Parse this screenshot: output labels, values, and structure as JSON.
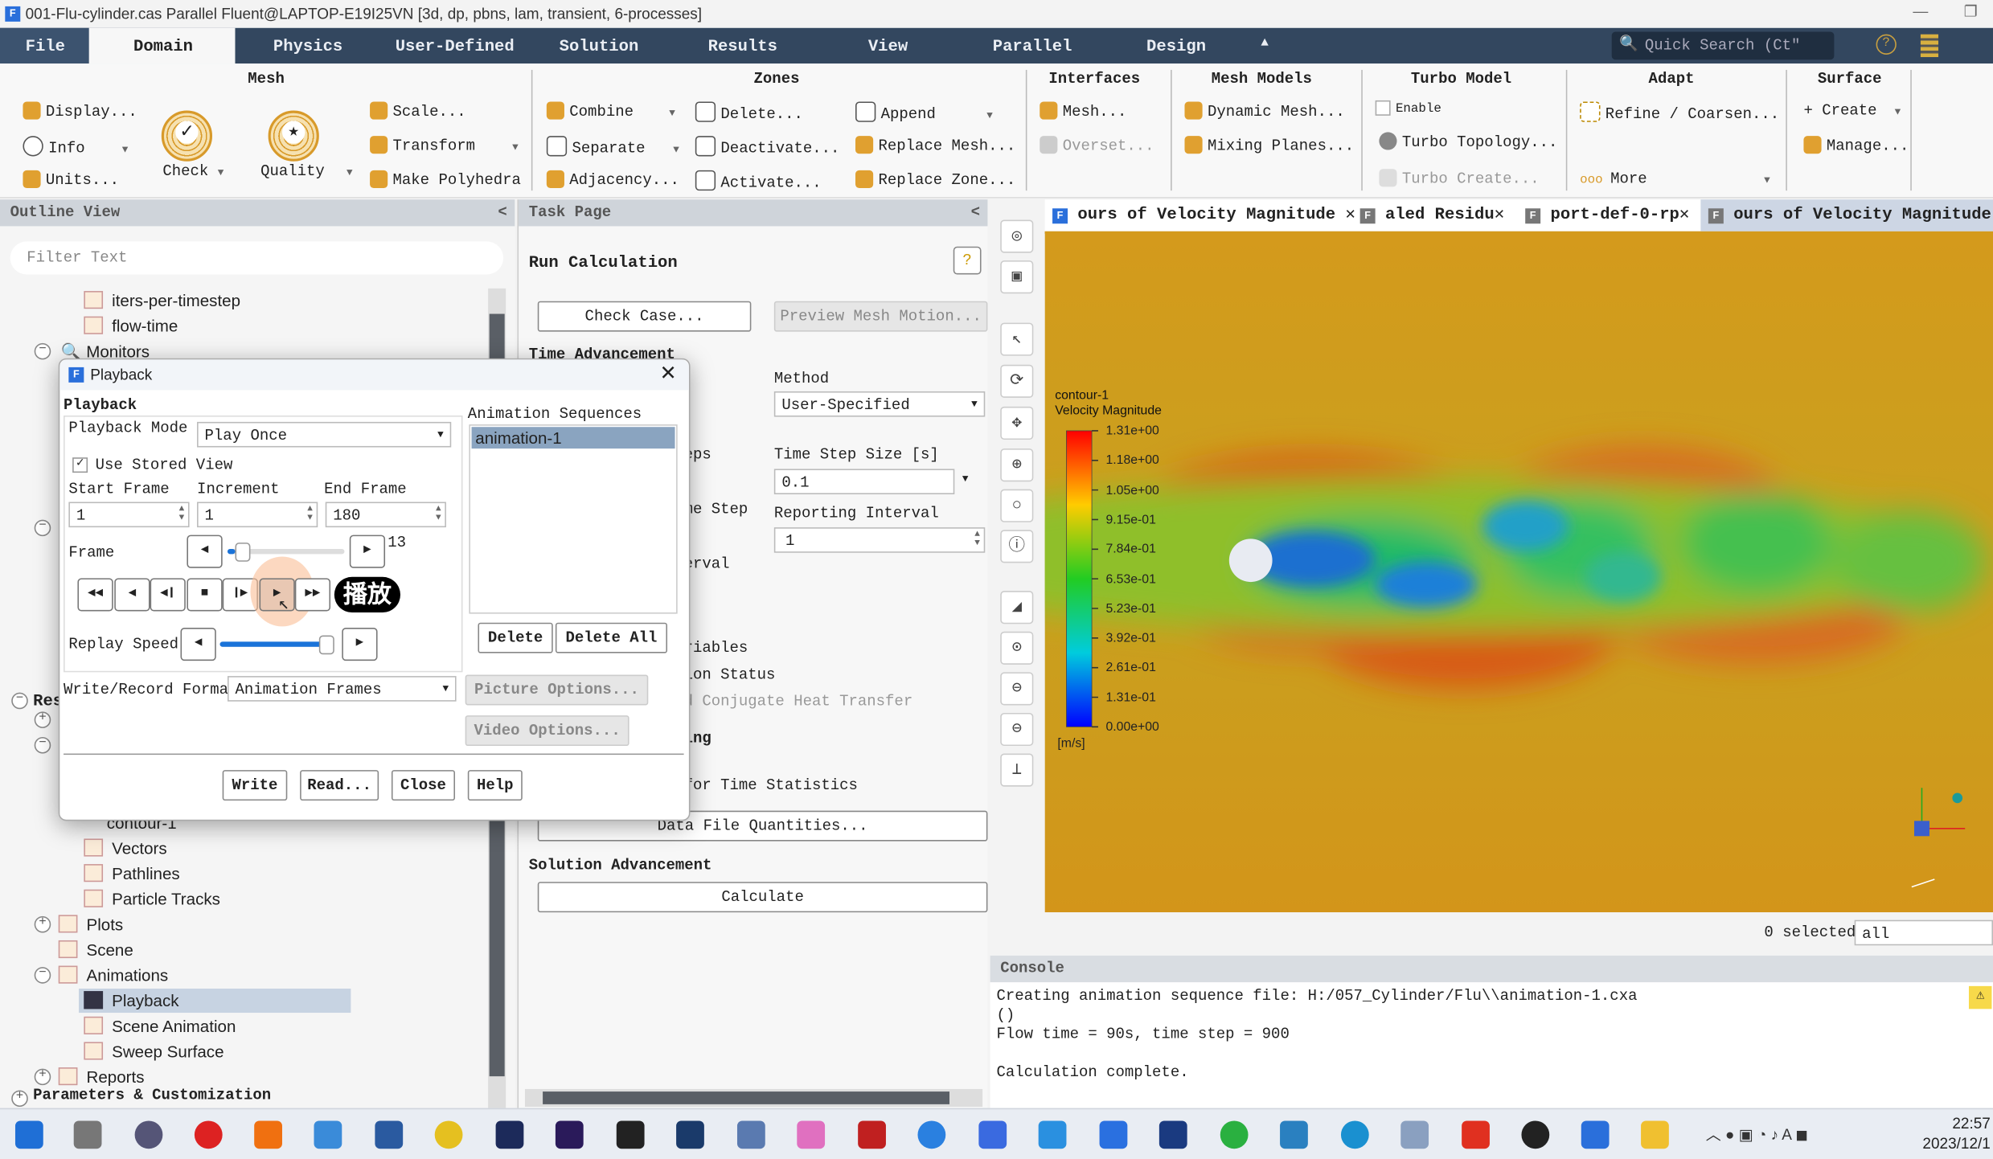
{
  "window": {
    "title": "001-Flu-cylinder.cas Parallel Fluent@LAPTOP-E19I25VN  [3d, dp, pbns, lam, transient, 6-processes]"
  },
  "menu": {
    "tabs": [
      "File",
      "Domain",
      "Physics",
      "User-Defined",
      "Solution",
      "Results",
      "View",
      "Parallel",
      "Design"
    ],
    "active": "Domain",
    "quick_search_placeholder": "Quick Search (Ct″"
  },
  "ribbon": {
    "mesh": {
      "title": "Mesh",
      "display": "Display...",
      "info": "Info",
      "units": "Units...",
      "check": "Check",
      "quality": "Quality",
      "scale": "Scale...",
      "transform": "Transform",
      "make_polyhedra": "Make Polyhedra"
    },
    "zones": {
      "title": "Zones",
      "combine": "Combine",
      "separate": "Separate",
      "adjacency": "Adjacency...",
      "delete": "Delete...",
      "deactivate": "Deactivate...",
      "activate": "Activate...",
      "append": "Append",
      "replace_mesh": "Replace Mesh...",
      "replace_zone": "Replace Zone..."
    },
    "interfaces": {
      "title": "Interfaces",
      "mesh": "Mesh...",
      "overset": "Overset..."
    },
    "mesh_models": {
      "title": "Mesh Models",
      "dynamic_mesh": "Dynamic Mesh...",
      "mixing_planes": "Mixing Planes..."
    },
    "turbo_model": {
      "title": "Turbo Model",
      "enable": "Enable",
      "turbo_topology": "Turbo Topology...",
      "turbo_create": "Turbo Create..."
    },
    "adapt": {
      "title": "Adapt",
      "refine": "Refine / Coarsen...",
      "more": "More"
    },
    "surface": {
      "title": "Surface",
      "create": "Create",
      "manage": "Manage..."
    }
  },
  "outline": {
    "title": "Outline View",
    "filter_placeholder": "Filter Text",
    "items_top": [
      "iters-per-timestep",
      "flow-time",
      "Monitors"
    ],
    "results_label": "Res",
    "items_bottom": [
      "contour-1",
      "Vectors",
      "Pathlines",
      "Particle Tracks",
      "Plots",
      "Scene",
      "Animations",
      "Playback",
      "Scene Animation",
      "Sweep Surface",
      "Reports"
    ],
    "selected": "Playback",
    "section_params": "Parameters & Customization"
  },
  "task": {
    "header": "Task Page",
    "title": "Run Calculation",
    "check_case": "Check Case...",
    "preview_mesh_motion": "Preview Mesh Motion...",
    "time_advancement": "Time Advancement",
    "method_label": "Method",
    "method_value": "User-Specified",
    "steps_label": "eps",
    "time_step_size_label": "Time Step Size [s]",
    "time_step_size_value": "0.1",
    "iter_label": "me Step",
    "reporting_interval_label": "Reporting Interval",
    "reporting_interval_value": "1",
    "profile_label": "erval",
    "opt1": "riables",
    "opt2": "ion Status",
    "opt3": "d Conjugate Heat Transfer",
    "sec2": "ing",
    "stats": "for Time Statistics",
    "data_file_quantities": "Data File Quantities...",
    "solution_advancement": "Solution Advancement",
    "calculate": "Calculate"
  },
  "graphics": {
    "tabs": [
      "ours of Velocity Magnitude",
      "aled Residu",
      "port-def-0-rp",
      "ours of Velocity Magnitude"
    ],
    "legend_title1": "contour-1",
    "legend_title2": "Velocity Magnitude",
    "legend_unit": "[m/s]",
    "legend_ticks": [
      "1.31e+00",
      "1.18e+00",
      "1.05e+00",
      "9.15e-01",
      "7.84e-01",
      "6.53e-01",
      "5.23e-01",
      "3.92e-01",
      "2.61e-01",
      "1.31e-01",
      "0.00e+00"
    ],
    "selected_count": "0 selected",
    "selection_filter": "all"
  },
  "console": {
    "title": "Console",
    "lines": [
      "Creating animation sequence file: H:/057_Cylinder/Flu\\\\animation-1.cxa",
      "()",
      "Flow time = 90s, time step = 900",
      "",
      "Calculation complete."
    ]
  },
  "dialog": {
    "title": "Playback",
    "section": "Playback",
    "playback_mode_label": "Playback Mode",
    "playback_mode_value": "Play Once",
    "use_stored_view": "Use Stored View",
    "use_stored_view_checked": true,
    "start_frame_label": "Start Frame",
    "start_frame": "1",
    "increment_label": "Increment",
    "increment": "1",
    "end_frame_label": "End Frame",
    "end_frame": "180",
    "frame_label": "Frame",
    "frame_value": "13",
    "replay_speed_label": "Replay Speed",
    "replay_speed_fraction": 0.95,
    "play_overlay": "播放",
    "write_format_label": "Write/Record Format",
    "write_format_value": "Animation Frames",
    "picture_options": "Picture Options...",
    "video_options": "Video Options...",
    "sequences_label": "Animation Sequences",
    "sequences": [
      "animation-1"
    ],
    "delete": "Delete",
    "delete_all": "Delete All",
    "write": "Write",
    "read": "Read...",
    "close": "Close",
    "help": "Help"
  },
  "taskbar": {
    "time": "22:57",
    "date": "2023/12/1"
  },
  "colors": {
    "menu_bg": "#33475f",
    "accent": "#2a6fdb",
    "selection": "#8aa4c0"
  }
}
